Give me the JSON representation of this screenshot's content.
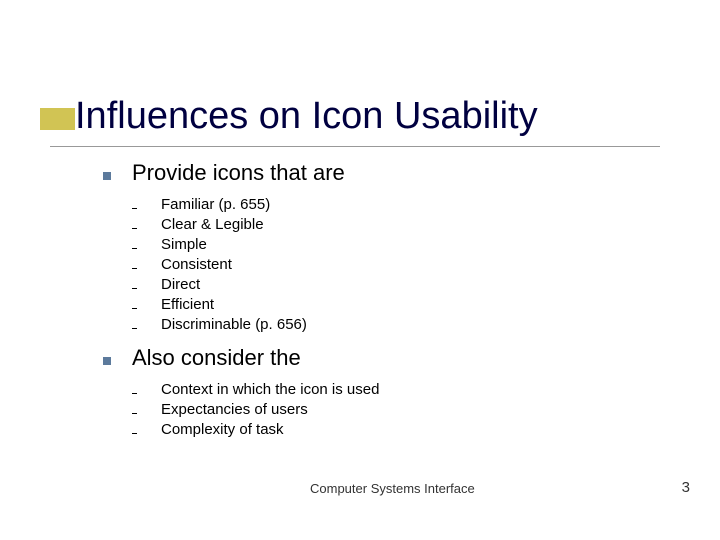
{
  "title": "Influences on Icon Usability",
  "sections": [
    {
      "heading": "Provide icons that are",
      "items": [
        "Familiar (p. 655)",
        "Clear & Legible",
        "Simple",
        "Consistent",
        "Direct",
        "Efficient",
        "Discriminable (p. 656)"
      ]
    },
    {
      "heading": "Also consider the",
      "items": [
        "Context in which the icon is used",
        "Expectancies of users",
        "Complexity of task"
      ]
    }
  ],
  "footer": "Computer Systems Interface",
  "page": "3"
}
